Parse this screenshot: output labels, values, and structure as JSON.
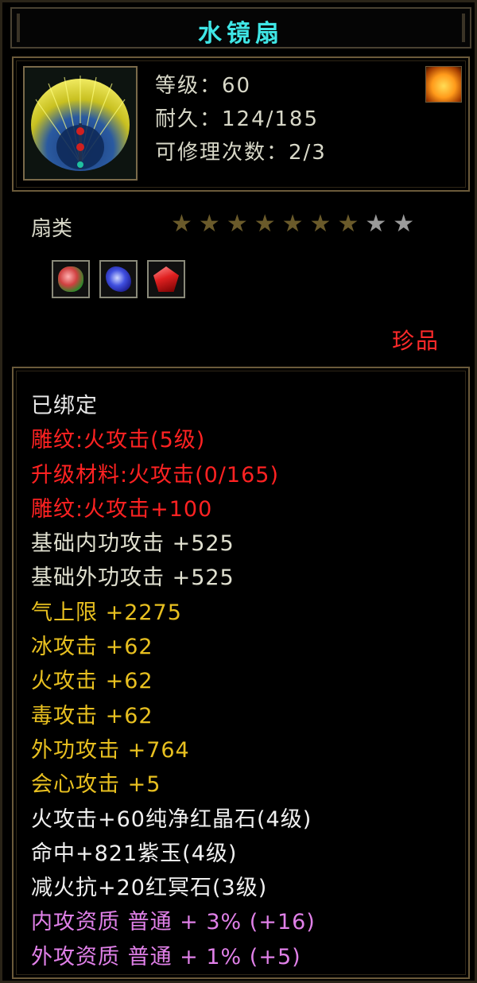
{
  "title": "水镜扇",
  "item": {
    "icon": "peacock-feather-fan-icon",
    "element_icon": "fire-element-icon",
    "stats": [
      "等级：60",
      "耐久：124/185",
      "可修理次数：2/3"
    ]
  },
  "category": "扇类",
  "stars": {
    "filled": 7,
    "total": 9
  },
  "gems": [
    "green-gem-icon",
    "blue-gem-icon",
    "red-gem-icon"
  ],
  "rarity": "珍品",
  "attributes": [
    {
      "text": "已绑定",
      "color": "#e8e8e8"
    },
    {
      "text": "雕纹:火攻击(5级)",
      "color": "#ff2222"
    },
    {
      "text": "升级材料:火攻击(0/165)",
      "color": "#ff2222"
    },
    {
      "text": "雕纹:火攻击+100",
      "color": "#ff2222"
    },
    {
      "text": "基础内功攻击 +525",
      "color": "#e0e0d0"
    },
    {
      "text": "基础外功攻击 +525",
      "color": "#e0e0d0"
    },
    {
      "text": "气上限 +2275",
      "color": "#e8c020"
    },
    {
      "text": "冰攻击 +62",
      "color": "#e8c020"
    },
    {
      "text": "火攻击 +62",
      "color": "#e8c020"
    },
    {
      "text": "毒攻击 +62",
      "color": "#e8c020"
    },
    {
      "text": "外功攻击 +764",
      "color": "#e8c020"
    },
    {
      "text": "会心攻击 +5",
      "color": "#e8c020"
    },
    {
      "text": "火攻击+60纯净红晶石(4级)",
      "color": "#f0f0f0"
    },
    {
      "text": "命中+821紫玉(4级)",
      "color": "#f0f0f0"
    },
    {
      "text": "减火抗+20红冥石(3级)",
      "color": "#f0f0f0"
    },
    {
      "text": "内攻资质 普通 + 3% (+16)",
      "color": "#e080e8"
    },
    {
      "text": "外攻资质 普通 + 1% (+5)",
      "color": "#e080e8"
    }
  ],
  "colors": {
    "title": "#3fe6e6",
    "rarity": "#ff2a2a",
    "star_filled": "#6a5a2a",
    "star_empty": "#9a9a9a"
  }
}
